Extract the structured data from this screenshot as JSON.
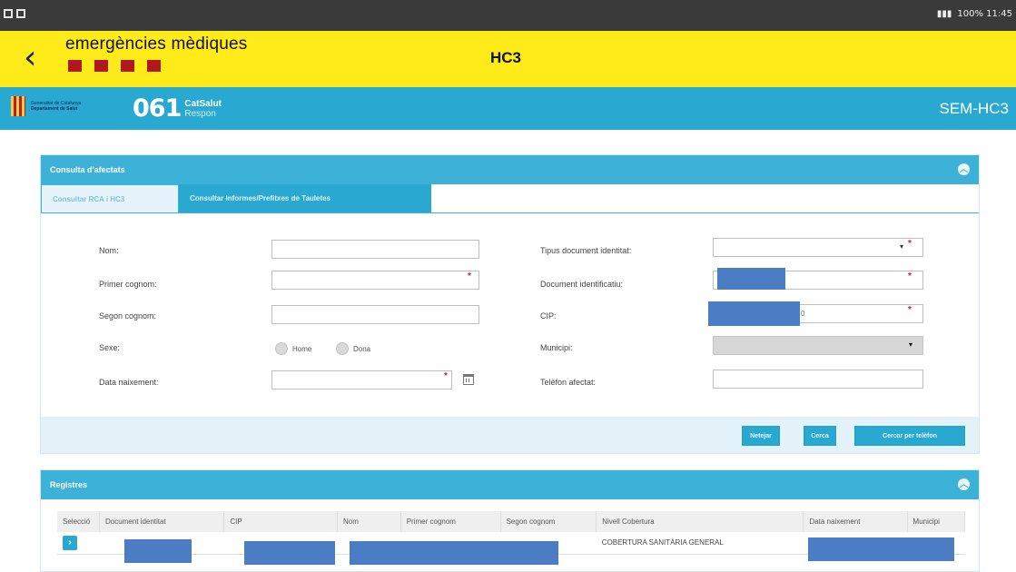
{
  "status_bar": {
    "right_text": "100% 11:45"
  },
  "header": {
    "brand": "emergències mèdiques",
    "title": "HC3"
  },
  "subheader": {
    "logo_number": "061",
    "logo_brand": "CatSalut",
    "logo_sub": "Respon",
    "gov_line1": "Generalitat de Catalunya",
    "gov_line2": "Departament de Salut",
    "right_label": "SEM-HC3"
  },
  "search_panel": {
    "title": "Consulta d'afectats",
    "tabs": [
      {
        "label": "Consultar RCA i HC3",
        "active": true
      },
      {
        "label": "Consultar Informes/Prefitxes de Tauletes",
        "active": false
      }
    ],
    "fields": {
      "nom": {
        "label": "Nom:"
      },
      "primer_cognom": {
        "label": "Primer cognom:"
      },
      "segon_cognom": {
        "label": "Segon cognom:"
      },
      "sexe": {
        "label": "Sexe:",
        "options": [
          "Home",
          "Dona"
        ]
      },
      "data_naixement": {
        "label": "Data naixement:"
      },
      "tipus_document": {
        "label": "Tipus document identitat:"
      },
      "document": {
        "label": "Document identificatiu:"
      },
      "cip": {
        "label": "CIP:",
        "value_suffix": "0"
      },
      "municipi": {
        "label": "Municipi:"
      },
      "telefon": {
        "label": "Telèfon afectat:"
      }
    },
    "buttons": {
      "clear": "Netejar",
      "search": "Cerca",
      "search_phone": "Cercar per telèfon"
    }
  },
  "results_panel": {
    "title": "Registres",
    "columns": [
      "Selecció",
      "Document identitat",
      "CIP",
      "Nom",
      "Primer cognom",
      "Segon cognom",
      "Nivell Cobertura",
      "Data naixement",
      "Municipi"
    ],
    "rows": [
      {
        "select": "›",
        "nivell_cobertura": "COBERTURA SANITÀRIA GENERAL"
      }
    ]
  },
  "colors": {
    "header_yellow": "#ffeb1a",
    "brand_blue": "#29a8d2",
    "required_red": "#d5202a"
  }
}
